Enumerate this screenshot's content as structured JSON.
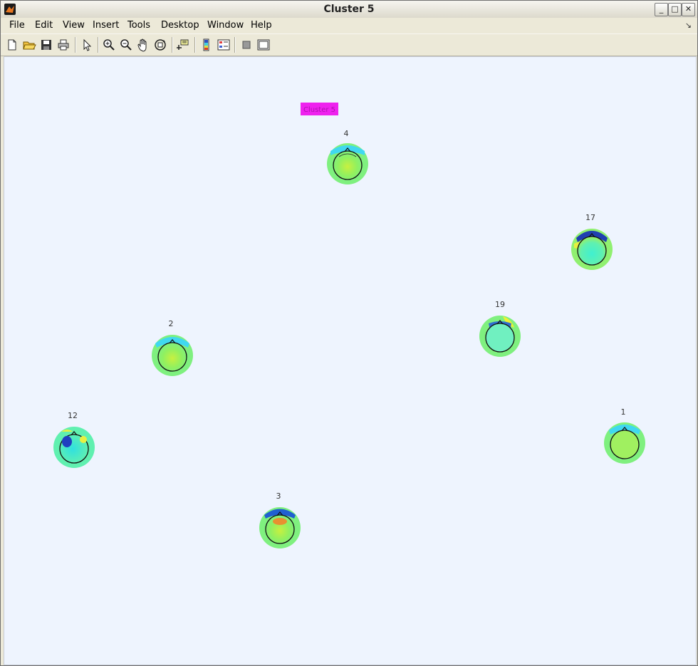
{
  "window": {
    "title": "Cluster 5"
  },
  "menu": {
    "items": [
      {
        "label": "File"
      },
      {
        "label": "Edit"
      },
      {
        "label": "View"
      },
      {
        "label": "Insert"
      },
      {
        "label": "Tools"
      },
      {
        "label": "Desktop"
      },
      {
        "label": "Window"
      },
      {
        "label": "Help"
      }
    ]
  },
  "toolbar": {
    "icons": [
      "new-figure-icon",
      "open-file-icon",
      "save-icon",
      "print-icon",
      "pointer-icon",
      "zoom-in-icon",
      "zoom-out-icon",
      "pan-hand-icon",
      "rotate-3d-icon",
      "data-cursor-icon",
      "colorbar-icon",
      "legend-icon",
      "hide-plot-tools-icon",
      "show-plot-tools-icon"
    ]
  },
  "figure": {
    "label_box": {
      "text": "Cluster 5",
      "color": "#ee22ee"
    },
    "topoplots": [
      {
        "label": "4",
        "scheme": "a"
      },
      {
        "label": "17",
        "scheme": "b"
      },
      {
        "label": "19",
        "scheme": "c"
      },
      {
        "label": "2",
        "scheme": "a"
      },
      {
        "label": "12",
        "scheme": "d"
      },
      {
        "label": "1",
        "scheme": "e"
      },
      {
        "label": "3",
        "scheme": "a"
      }
    ]
  },
  "colors": {
    "figure_bg": "#eef4fe",
    "map_base": "#7ff07f",
    "map_cyan": "#40f0d0",
    "map_yellow": "#e8f040",
    "map_blue": "#2040c0"
  }
}
